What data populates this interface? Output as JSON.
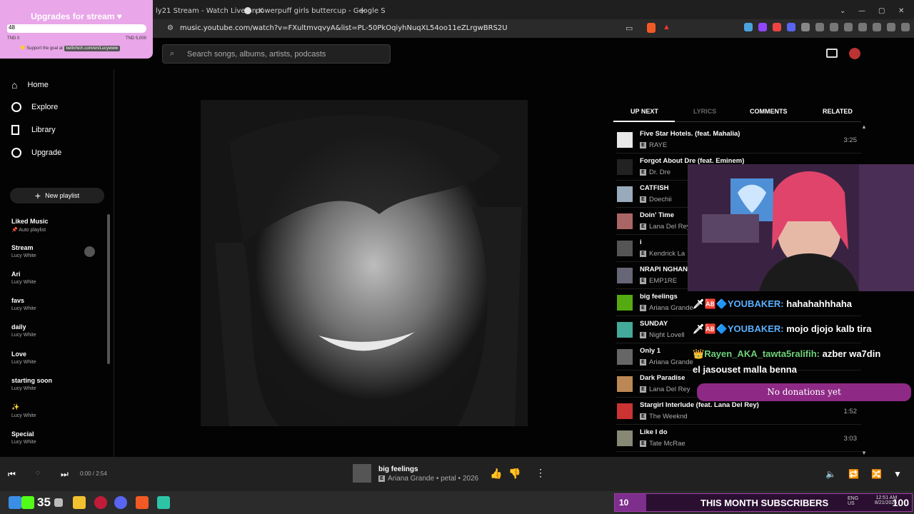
{
  "browser": {
    "tabs": [
      {
        "label": "ly21 Stream - Watch Live on K"
      },
      {
        "label": "powerpuff girls buttercup - Google S"
      }
    ],
    "new_tab": "+",
    "url": "music.youtube.com/watch?v=FXultmvqvyA&list=PL-50PkOqiyhNuqXL54oo11eZLrgwBRS2U"
  },
  "goal_overlay": {
    "title": "Upgrades for stream ♥",
    "current": "48",
    "progress": 0.0096,
    "min": "TND 0",
    "max": "TND 5,000",
    "support_text": "💛 Support the goal at",
    "support_link": "be9chich.com/en/Lucywww"
  },
  "header": {
    "search_placeholder": "Search songs, albums, artists, podcasts"
  },
  "sidebar": {
    "nav": [
      {
        "label": "Home"
      },
      {
        "label": "Explore"
      },
      {
        "label": "Library"
      },
      {
        "label": "Upgrade"
      }
    ],
    "new_playlist": "New playlist",
    "playlists": [
      {
        "name": "Liked Music",
        "owner": "Auto playlist"
      },
      {
        "name": "Stream",
        "owner": "Lucy White"
      },
      {
        "name": "Ari",
        "owner": "Lucy White"
      },
      {
        "name": "favs",
        "owner": "Lucy White"
      },
      {
        "name": "daily",
        "owner": "Lucy White"
      },
      {
        "name": "Love",
        "owner": "Lucy White"
      },
      {
        "name": "starting soon",
        "owner": "Lucy White"
      },
      {
        "name": "✨",
        "owner": "Lucy White"
      },
      {
        "name": "Special",
        "owner": "Lucy White"
      }
    ]
  },
  "panel": {
    "tabs": [
      "UP NEXT",
      "LYRICS",
      "COMMENTS",
      "RELATED"
    ],
    "queue": [
      {
        "title": "Five Star Hotels. (feat. Mahalia)",
        "artist": "RAYE",
        "duration": "3:25"
      },
      {
        "title": "Forgot About Dre (feat. Eminem)",
        "artist": "Dr. Dre",
        "duration": ""
      },
      {
        "title": "CATFISH",
        "artist": "Doechii",
        "duration": ""
      },
      {
        "title": "Doin' Time",
        "artist": "Lana Del Rey",
        "duration": ""
      },
      {
        "title": "i",
        "artist": "Kendrick La",
        "duration": ""
      },
      {
        "title": "NRAPI NGHAN",
        "artist": "EMP1RE",
        "duration": ""
      },
      {
        "title": "big feelings",
        "artist": "Ariana Grande",
        "duration": ""
      },
      {
        "title": "SUNDAY",
        "artist": "Night Lovell",
        "duration": ""
      },
      {
        "title": "Only 1",
        "artist": "Ariana Grande",
        "duration": ""
      },
      {
        "title": "Dark Paradise",
        "artist": "Lana Del Rey",
        "duration": ""
      },
      {
        "title": "Stargirl Interlude (feat. Lana Del Rey)",
        "artist": "The Weeknd",
        "duration": "1:52"
      },
      {
        "title": "Like I do",
        "artist": "Tate McRae",
        "duration": "3:03"
      }
    ]
  },
  "chat": [
    {
      "user": "YOUBAKER:",
      "msg": "hahahahhhaha"
    },
    {
      "user": "YOUBAKER:",
      "msg": "mojo djojo kalb tira"
    },
    {
      "user": "Rayen_AKA_tawta5ralifih:",
      "msg": "azber wa7din"
    },
    {
      "user": "",
      "msg": "el jasouset malla benna"
    }
  ],
  "donation": "No donations yet",
  "player": {
    "time": "0:00 / 2:54",
    "title": "big feelings",
    "meta": "Ariana Grande • petal • 2026"
  },
  "taskbar": {
    "counter": "35",
    "subs_count": "10",
    "subs_label": "THIS MONTH SUBSCRIBERS",
    "subs_goal": "100",
    "lang1": "ENG",
    "lang2": "US",
    "clock": "12:51 AM",
    "date": "8/21/2026"
  }
}
